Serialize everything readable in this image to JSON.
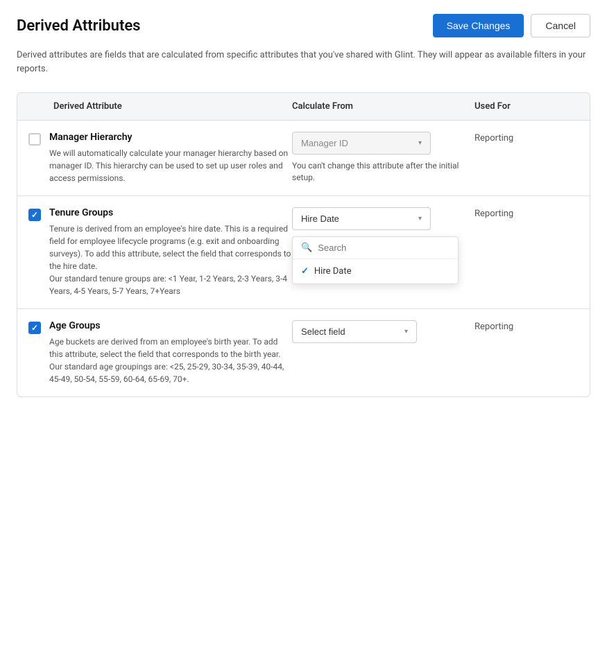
{
  "header": {
    "title": "Derived Attributes",
    "save_label": "Save Changes",
    "cancel_label": "Cancel"
  },
  "description": "Derived attributes are fields that are calculated from specific attributes that you've shared with Glint. They will appear as available filters in your reports.",
  "table": {
    "columns": [
      "Derived Attribute",
      "Calculate From",
      "Used For"
    ],
    "rows": [
      {
        "id": "manager-hierarchy",
        "checked": false,
        "name": "Manager Hierarchy",
        "description": "We will automatically calculate your manager hierarchy based on manager ID. This hierarchy can be used to set up user roles and access permissions.",
        "calculate_from": "Manager ID",
        "dropdown_note": "You can't change this attribute after the initial setup.",
        "used_for": "Reporting",
        "dropdown_open": false,
        "disabled": true
      },
      {
        "id": "tenure-groups",
        "checked": true,
        "name": "Tenure Groups",
        "description": "Tenure is derived from an employee's hire date. This is a required field for employee lifecycle programs (e.g. exit and onboarding surveys). To add this attribute, select the field that corresponds to the hire date.\nOur standard tenure groups are: <1 Year, 1-2 Years, 2-3 Years, 3-4 Years, 4-5 Years, 5-7 Years, 7+Years",
        "calculate_from": "Hire Date",
        "used_for": "Reporting",
        "dropdown_open": true,
        "search_placeholder": "Search",
        "dropdown_items": [
          {
            "label": "Hire Date",
            "selected": true
          }
        ]
      },
      {
        "id": "age-groups",
        "checked": true,
        "name": "Age Groups",
        "description": "Age buckets are derived from an employee's birth year. To add this attribute, select the field that corresponds to the birth year.\nOur standard age groupings are: <25, 25-29, 30-34, 35-39, 40-44, 45-49, 50-54, 55-59, 60-64, 65-69, 70+.",
        "calculate_from": "Select field",
        "used_for": "Reporting",
        "dropdown_open": false
      }
    ]
  }
}
